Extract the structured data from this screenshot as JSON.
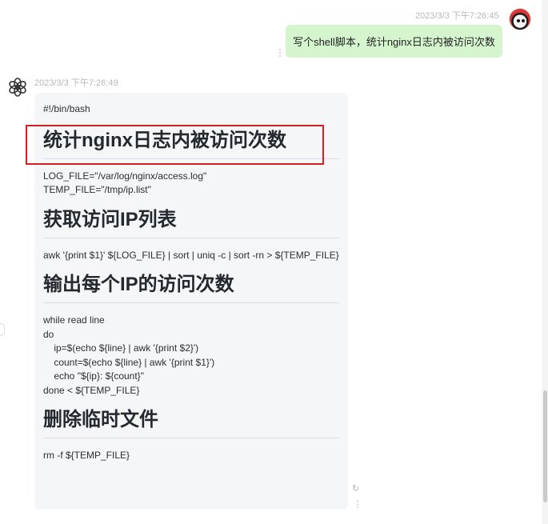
{
  "user_message": {
    "timestamp": "2023/3/3 下午7:26:45",
    "text": "写个shell脚本，统计nginx日志内被访问次数"
  },
  "bot_message": {
    "timestamp": "2023/3/3 下午7:26:49",
    "shebang": "#!/bin/bash",
    "sections": [
      {
        "heading": "统计nginx日志内被访问次数",
        "lines": [
          "LOG_FILE=\"/var/log/nginx/access.log\"",
          "TEMP_FILE=\"/tmp/ip.list\""
        ]
      },
      {
        "heading": "获取访问IP列表",
        "lines": [
          "awk '{print $1}' ${LOG_FILE} | sort | uniq -c | sort -rn > ${TEMP_FILE}"
        ]
      },
      {
        "heading": "输出每个IP的访问次数",
        "lines": [
          "while read line",
          "do",
          "    ip=$(echo ${line} | awk '{print $2}')",
          "    count=$(echo ${line} | awk '{print $1}')",
          "    echo \"${ip}: ${count}\"",
          "done < ${TEMP_FILE}"
        ]
      },
      {
        "heading": "删除临时文件",
        "lines": [
          "rm -f ${TEMP_FILE}"
        ]
      }
    ]
  },
  "icons": {
    "user_avatar": "user-avatar-icon",
    "bot_avatar": "openai-logo-icon",
    "more": "more-dots-icon",
    "refresh": "refresh-icon"
  },
  "colors": {
    "user_bubble": "#d5f5cf",
    "bot_bubble": "#f4f6f8",
    "highlight": "#d6201f"
  }
}
